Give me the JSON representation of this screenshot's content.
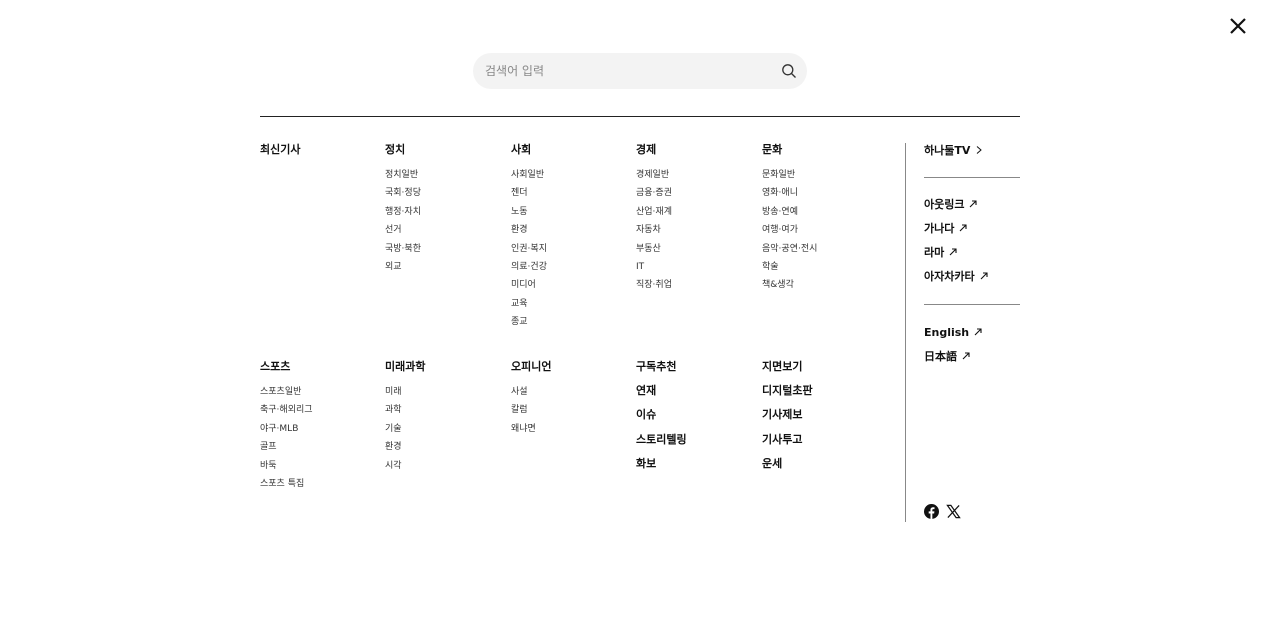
{
  "search": {
    "placeholder": "검색어 입력"
  },
  "sections_row1": [
    {
      "title": "최신기사",
      "items": []
    },
    {
      "title": "정치",
      "items": [
        "정치일반",
        "국회·정당",
        "행정·자치",
        "선거",
        "국방·북한",
        "외교"
      ]
    },
    {
      "title": "사회",
      "items": [
        "사회일반",
        "젠더",
        "노동",
        "환경",
        "인권·복지",
        "의료·건강",
        "미디어",
        "교육",
        "종교"
      ]
    },
    {
      "title": "경제",
      "items": [
        "경제일반",
        "금융·증권",
        "산업·재계",
        "자동차",
        "부동산",
        "IT",
        "직장·취업"
      ]
    },
    {
      "title": "문화",
      "items": [
        "문화일반",
        "영화·애니",
        "방송·연예",
        "여행·여가",
        "음악·공연·전시",
        "학술",
        "책&생각"
      ]
    }
  ],
  "sections_row2": [
    {
      "title": "스포츠",
      "items": [
        "스포츠일반",
        "축구·해외리그",
        "야구·MLB",
        "골프",
        "바둑",
        "스포츠 특집"
      ]
    },
    {
      "title": "미래과학",
      "items": [
        "미래",
        "과학",
        "기술",
        "환경",
        "시각"
      ]
    },
    {
      "title": "오피니언",
      "items": [
        "사설",
        "칼럼",
        "왜냐면"
      ]
    }
  ],
  "bold_col1": [
    "구독추천",
    "연재",
    "이슈",
    "스토리텔링",
    "화보"
  ],
  "bold_col2": [
    "지면보기",
    "디지털초판",
    "기사제보",
    "기사투고",
    "운세"
  ],
  "side": {
    "tv": "하나둘TV",
    "group1": [
      "아웃링크",
      "가나다",
      "라마",
      "아자차카타"
    ],
    "group2": [
      "English",
      "日本語"
    ]
  }
}
